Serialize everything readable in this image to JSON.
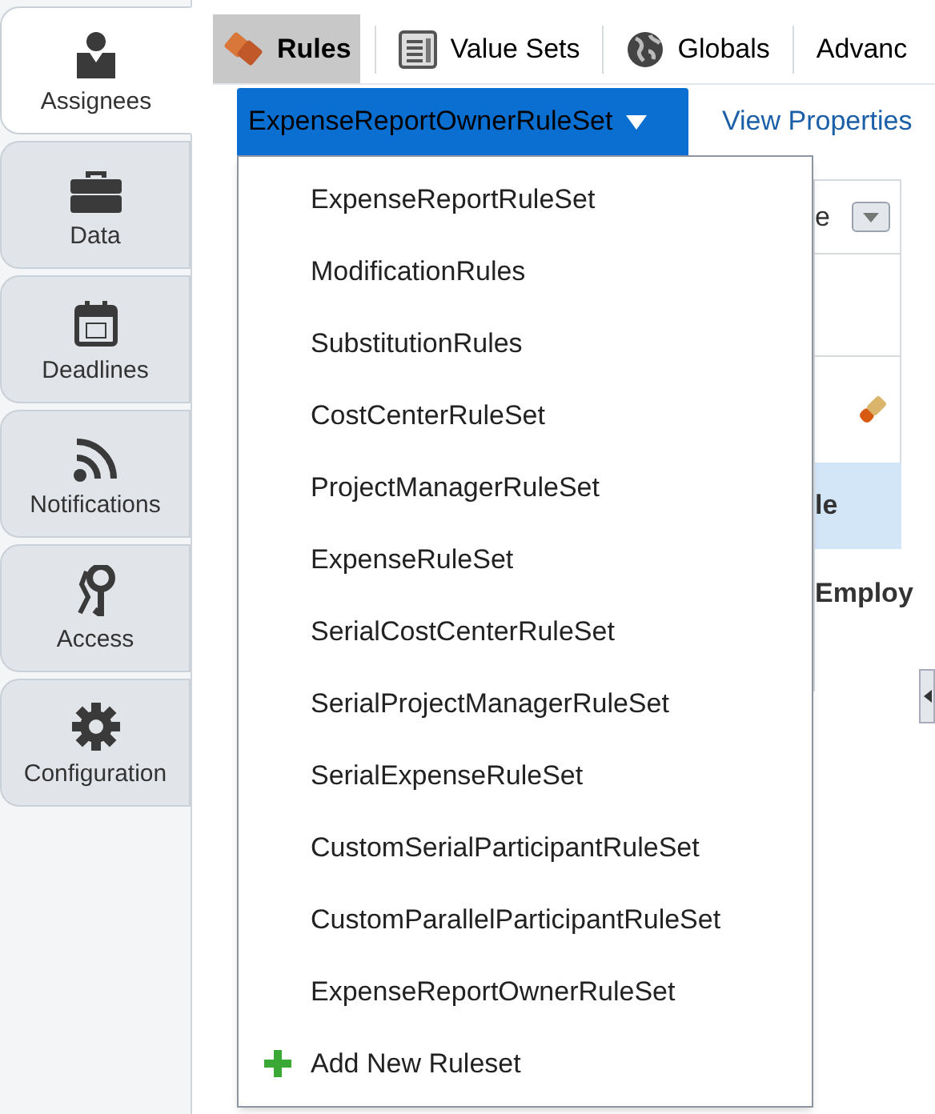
{
  "sidebar": {
    "items": [
      {
        "label": "Assignees",
        "selected": true
      },
      {
        "label": "Data",
        "selected": false
      },
      {
        "label": "Deadlines",
        "selected": false
      },
      {
        "label": "Notifications",
        "selected": false
      },
      {
        "label": "Access",
        "selected": false
      },
      {
        "label": "Configuration",
        "selected": false
      }
    ]
  },
  "tabs": [
    {
      "label": "Rules",
      "selected": true
    },
    {
      "label": "Value Sets",
      "selected": false
    },
    {
      "label": "Globals",
      "selected": false
    },
    {
      "label": "Advanc",
      "selected": false
    }
  ],
  "ruleset_select": {
    "value": "ExpenseReportOwnerRuleSet"
  },
  "view_properties": "View Properties",
  "background_table": {
    "header": "e",
    "selected_row": "le",
    "bold_text": "Employ"
  },
  "dropdown": {
    "items": [
      {
        "label": "ExpenseReportRuleSet",
        "kind": "option"
      },
      {
        "label": "ModificationRules",
        "kind": "option"
      },
      {
        "label": "SubstitutionRules",
        "kind": "option"
      },
      {
        "label": "CostCenterRuleSet",
        "kind": "option"
      },
      {
        "label": "ProjectManagerRuleSet",
        "kind": "option"
      },
      {
        "label": "ExpenseRuleSet",
        "kind": "option"
      },
      {
        "label": "SerialCostCenterRuleSet",
        "kind": "option"
      },
      {
        "label": "SerialProjectManagerRuleSet",
        "kind": "option"
      },
      {
        "label": "SerialExpenseRuleSet",
        "kind": "option"
      },
      {
        "label": "CustomSerialParticipantRuleSet",
        "kind": "option"
      },
      {
        "label": "CustomParallelParticipantRuleSet",
        "kind": "option"
      },
      {
        "label": "ExpenseReportOwnerRuleSet",
        "kind": "option"
      },
      {
        "label": "Add New Ruleset",
        "kind": "add"
      }
    ]
  }
}
